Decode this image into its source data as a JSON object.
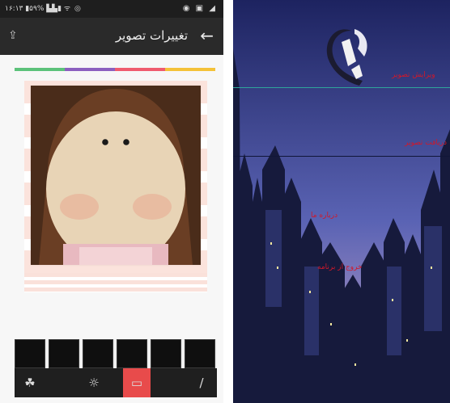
{
  "status_bar": {
    "left": "۱۶:۱۳ ▮۵۹% ▙▙▮ ᯤ ◎",
    "right": "◉ ▣ ◢"
  },
  "toolbar": {
    "title": "تغییرات تصویر",
    "back_icon": "arrow-left-icon",
    "share_icon": "share-icon"
  },
  "color_bar": [
    "#5cc27a",
    "#8b5fbf",
    "#ef5b6e",
    "#f4c238"
  ],
  "thumbnails": [
    "",
    "",
    "",
    "",
    "",
    ""
  ],
  "bottom_tools": [
    {
      "icon": "palette-icon",
      "active": false
    },
    {
      "icon": "brightness-icon",
      "active": false
    },
    {
      "icon": "frame-icon",
      "active": true
    },
    {
      "icon": "pencil-icon",
      "active": false
    }
  ],
  "accent": "#e84b4b",
  "right_panel": {
    "labels": [
      "ویرایش تصویر",
      "دریافت تصویر",
      "درباره ما",
      "خروج از برنامه"
    ]
  }
}
